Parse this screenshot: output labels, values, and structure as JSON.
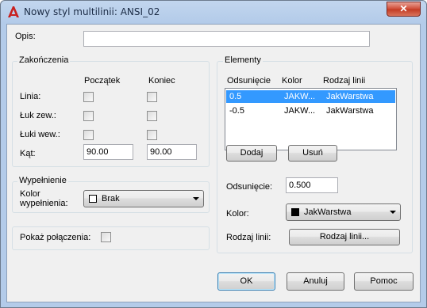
{
  "window": {
    "title": "Nowy styl multilinii: ANSI_02",
    "close_label": "✕"
  },
  "description": {
    "label": "Opis:",
    "value": ""
  },
  "caps": {
    "group_label": "Zakończenia",
    "col_start": "Początek",
    "col_end": "Koniec",
    "rows": [
      {
        "label": "Linia:",
        "start_checked": false,
        "end_checked": false
      },
      {
        "label": "Łuk zew.:",
        "start_checked": false,
        "end_checked": false
      },
      {
        "label": "Łuki wew.:",
        "start_checked": false,
        "end_checked": false
      }
    ],
    "angle_label": "Kąt:",
    "angle_start": "90.00",
    "angle_end": "90.00"
  },
  "fill": {
    "group_label": "Wypełnienie",
    "color_label_line1": "Kolor",
    "color_label_line2": "wypełnienia:",
    "color_value": "Brak",
    "color_swatch": "#ffffff"
  },
  "show_joints": {
    "label": "Pokaż połączenia:",
    "checked": false
  },
  "elements": {
    "group_label": "Elementy",
    "headers": {
      "offset": "Odsunięcie",
      "color": "Kolor",
      "linetype": "Rodzaj linii"
    },
    "rows": [
      {
        "offset": "0.5",
        "color": "JAKW...",
        "linetype": "JakWarstwa",
        "selected": true
      },
      {
        "offset": "-0.5",
        "color": "JAKW...",
        "linetype": "JakWarstwa",
        "selected": false
      }
    ],
    "add_button": "Dodaj",
    "delete_button": "Usuń",
    "offset_label": "Odsunięcie:",
    "offset_value": "0.500",
    "color_label": "Kolor:",
    "color_value": "JakWarstwa",
    "color_swatch": "#000000",
    "linetype_label": "Rodzaj linii:",
    "linetype_button": "Rodzaj linii..."
  },
  "footer": {
    "ok": "OK",
    "cancel": "Anuluj",
    "help": "Pomoc"
  },
  "colors": {
    "selection": "#3399ff",
    "dialog_bg": "#f0f0f0",
    "titlebar": "#b9d1ea"
  }
}
